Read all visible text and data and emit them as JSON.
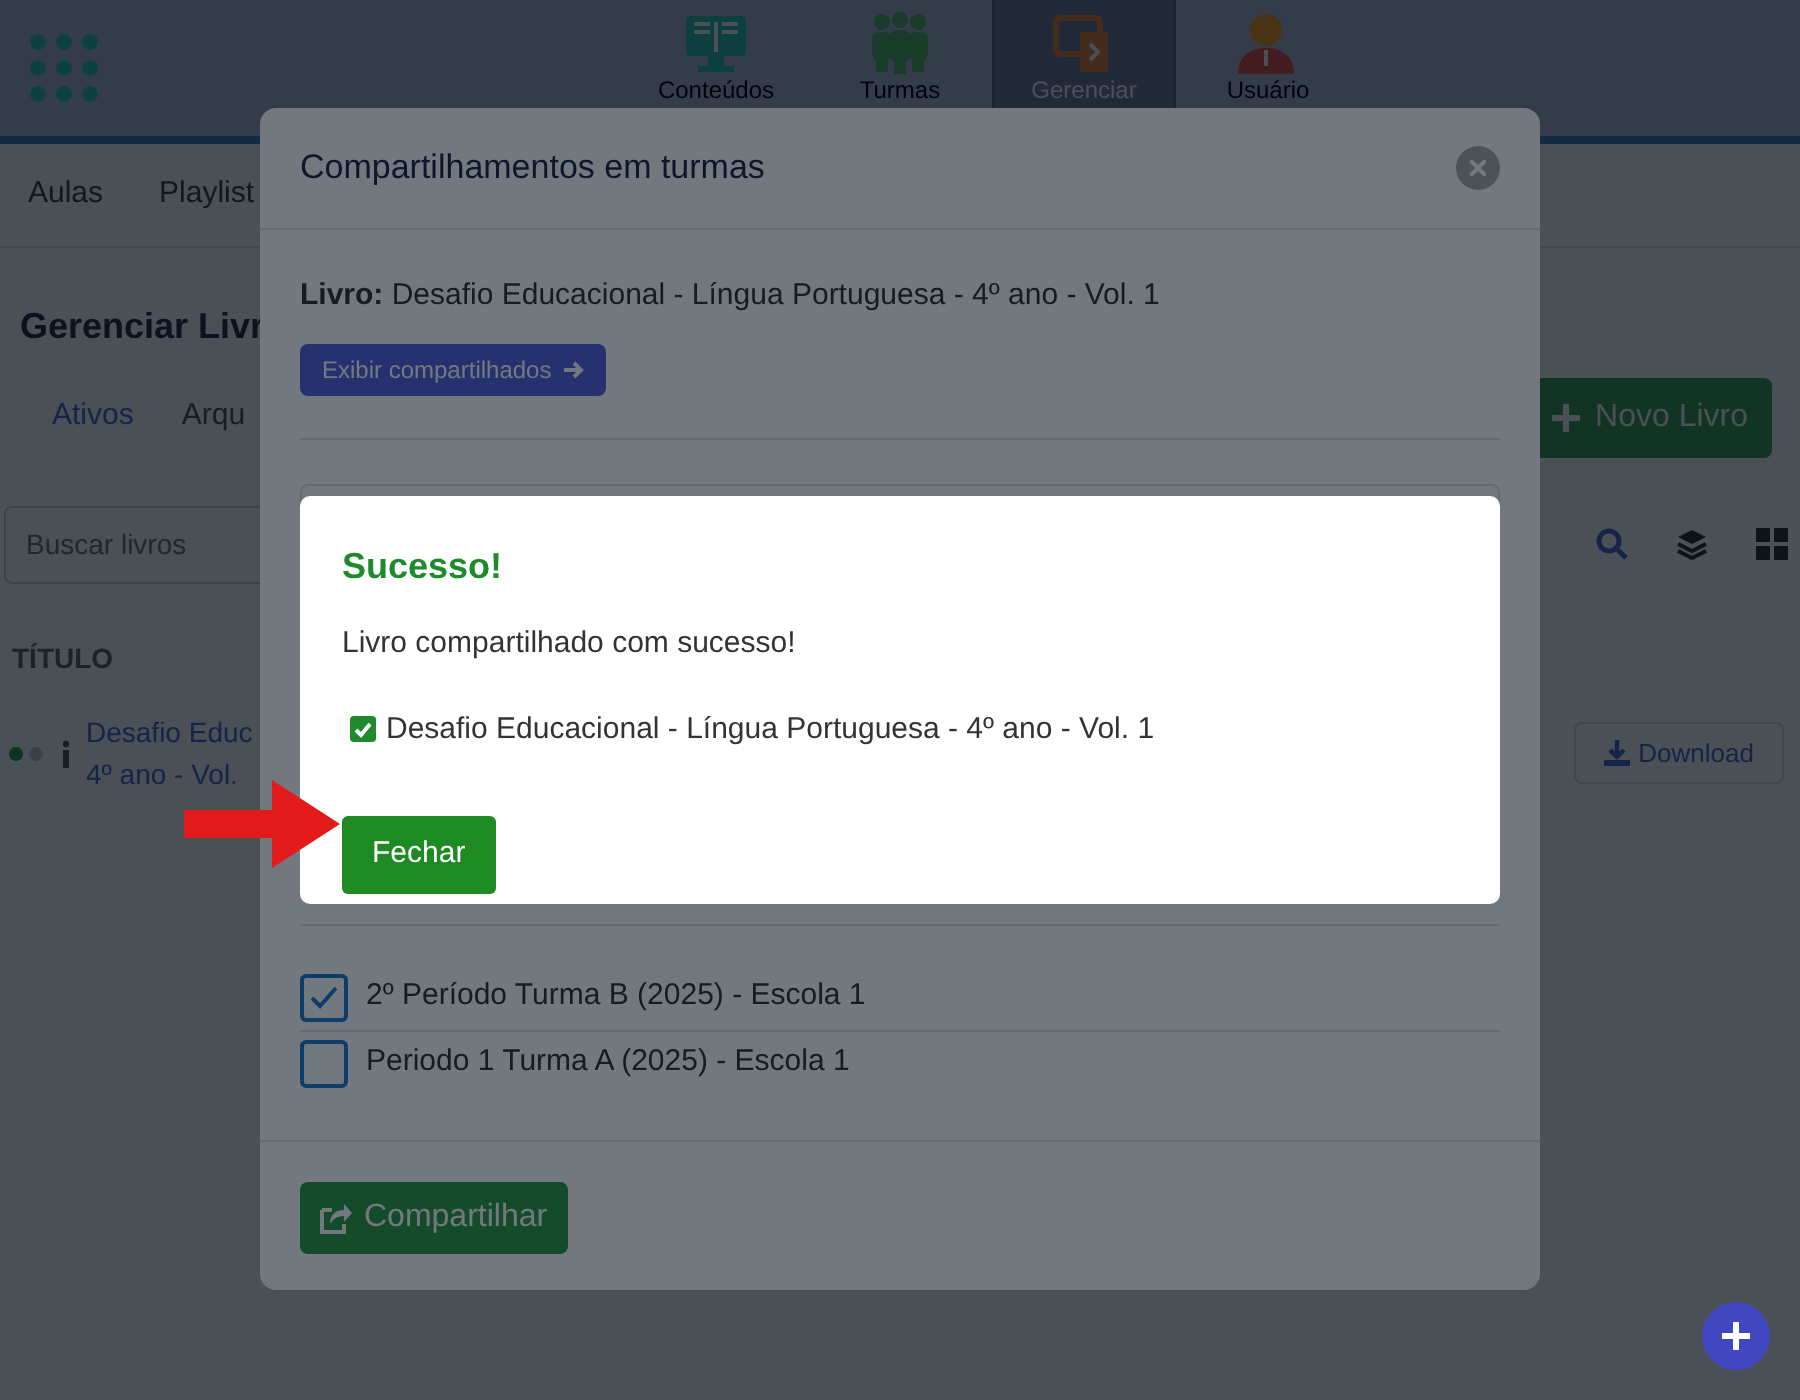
{
  "topbar": {
    "nav": [
      {
        "label": "Conteúdos",
        "selected": false
      },
      {
        "label": "Turmas",
        "selected": false
      },
      {
        "label": "Gerenciar",
        "selected": true
      },
      {
        "label": "Usuário",
        "selected": false
      }
    ]
  },
  "subnav": [
    "Aulas",
    "Playlist"
  ],
  "page": {
    "title": "Gerenciar Livr",
    "tabs": [
      {
        "label": "Ativos",
        "selected": true
      },
      {
        "label": "Arqu",
        "selected": false
      }
    ],
    "new_button": "Novo Livro",
    "search": {
      "placeholder": "Buscar livros"
    },
    "columns": [
      "TÍTULO"
    ],
    "rows": [
      {
        "title_lines": [
          "Desafio Educ",
          "4º ano - Vol."
        ],
        "action": "Download"
      }
    ]
  },
  "share_modal": {
    "title": "Compartilhamentos em turmas",
    "book_label": "Livro:",
    "book_title": "Desafio Educacional - Língua Portuguesa - 4º ano - Vol. 1",
    "show_button": "Exibir compartilhados",
    "classes": [
      {
        "label": "2º Período Turma B (2025) - Escola 1",
        "checked": true
      },
      {
        "label": "Periodo 1 Turma A (2025) - Escola 1",
        "checked": false
      }
    ],
    "share_button": "Compartilhar"
  },
  "success_modal": {
    "title": "Sucesso!",
    "message": "Livro compartilhado com sucesso!",
    "items": [
      {
        "label": "Desafio Educacional - Língua Portuguesa - 4º ano - Vol. 1",
        "checked": true
      }
    ],
    "close_button": "Fechar"
  }
}
